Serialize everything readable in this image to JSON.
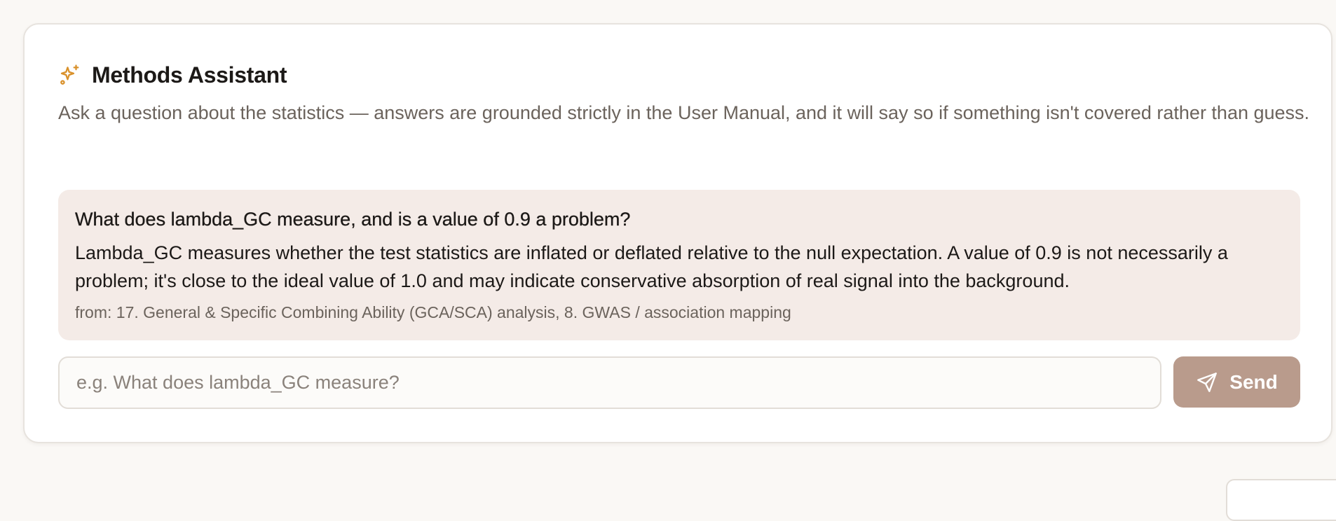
{
  "assistant": {
    "title": "Methods Assistant",
    "icon": "sparkles-icon",
    "description": "Ask a question about the statistics — answers are grounded strictly in the User Manual, and it will say so if something isn't covered rather than guess."
  },
  "conversation": {
    "question": "What does lambda_GC measure, and is a value of 0.9 a problem?",
    "answer": "Lambda_GC measures whether the test statistics are inflated or deflated relative to the null expectation. A value of 0.9 is not necessarily a problem; it's close to the ideal value of 1.0 and may indicate conservative absorption of real signal into the background.",
    "source": "from: 17. General & Specific Combining Ability (GCA/SCA) analysis, 8. GWAS / association mapping"
  },
  "input": {
    "value": "",
    "placeholder": "e.g. What does lambda_GC measure?"
  },
  "send_button": {
    "label": "Send",
    "icon": "send-icon"
  },
  "colors": {
    "accent_icon": "#d9912b",
    "answer_background": "#f4ebe7",
    "send_button": "#b99b8c",
    "page_background": "#faf8f5"
  }
}
